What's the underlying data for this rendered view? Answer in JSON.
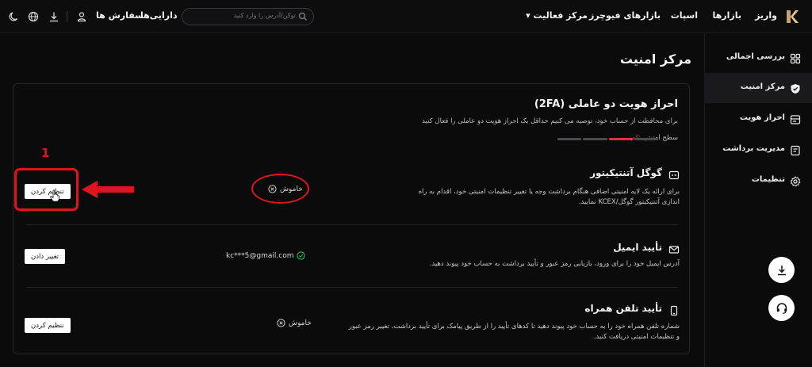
{
  "nav": {
    "logo": "kcex-logo",
    "links": {
      "deposit": "واریز",
      "markets": "بازارها",
      "spot": "اسپات",
      "futures": "بازارهای فیوچرز",
      "activity": "مرکز فعالیت ▾",
      "assets": "دارایی‌ها",
      "orders": "سفارش ها"
    },
    "search_placeholder": "توکن/آدرس را وارد کنید",
    "icons": [
      "search-icon",
      "user-icon",
      "download-icon",
      "globe-icon",
      "moon-icon"
    ]
  },
  "sidebar": {
    "items": [
      {
        "label": "بررسی اجمالی",
        "icon": "grid-icon"
      },
      {
        "label": "مرکز امنیت",
        "icon": "shield-icon",
        "active": true
      },
      {
        "label": "احراز هویت",
        "icon": "id-card-icon"
      },
      {
        "label": "مدیریت برداشت",
        "icon": "withdraw-icon"
      },
      {
        "label": "تنظیمات",
        "icon": "gear-icon"
      }
    ]
  },
  "page": {
    "title": "مرکز امنیت"
  },
  "twofa": {
    "title": "احراز هویت دو عاملی (2FA)",
    "subtitle": "برای محافظت از حساب خود، توصیه می کنیم حداقل یک احراز هویت دو عاملی را فعال کنید",
    "level_label": "سطح امنیتی",
    "level_value": ":کم",
    "level_filled": 1,
    "level_total": 4
  },
  "rows": [
    {
      "title": "گوگل آتنتیکیتور",
      "desc": "برای ارائه یک لایه امنیتی اضافی هنگام برداشت وجه یا تغییر تنظیمات امنیتی خود، اقدام به راه اندازی آتنتیکیتور گوگل/KCEX نمایید.",
      "status": "خاموش",
      "button": "تنظیم کردن"
    },
    {
      "title": "تأیید ایمیل",
      "desc": "آدرس ایمیل خود را برای ورود، بازیابی رمز عبور و تأیید برداشت به حساب خود پیوند دهید.",
      "status": "kc***5@gmail.com",
      "button": "تغییر دادن"
    },
    {
      "title": "تأیید تلفن همراه",
      "desc": "شماره تلفن همراه خود را به حساب خود پیوند دهید تا کدهای تأیید را از طریق پیامک برای تأیید برداشت، تغییر رمز عبور و تنظیمات امنیتی دریافت کنید.",
      "status": "خاموش",
      "button": "تنظیم کردن"
    }
  ],
  "annotation": {
    "number": "1",
    "color": "#e0141d"
  },
  "colors": {
    "background": "#0b0b0c",
    "low_level": "#e0313f",
    "verified": "#22c55e"
  }
}
